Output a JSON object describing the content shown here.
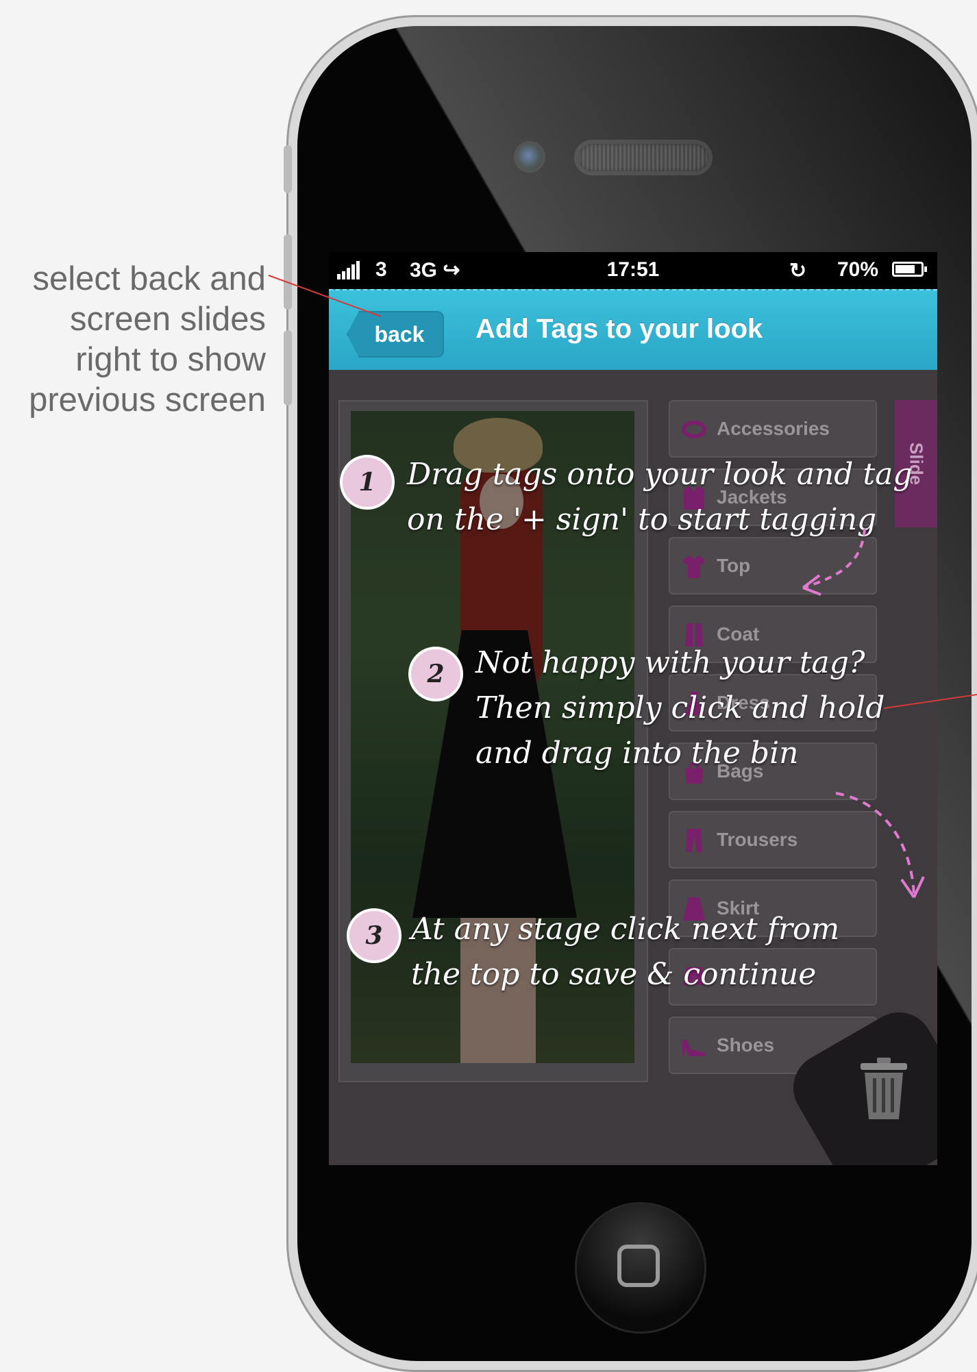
{
  "side_note": {
    "lines": [
      "select back and",
      "screen slides",
      "right to show",
      "previous screen"
    ]
  },
  "status_bar": {
    "carrier": "3",
    "network": "3G",
    "time": "17:51",
    "battery": "70%"
  },
  "nav": {
    "back_label": "back",
    "title": "Add Tags to your look"
  },
  "tags": [
    {
      "label": "Accessories",
      "icon": "accessories-icon"
    },
    {
      "label": "Jackets",
      "icon": "jacket-icon"
    },
    {
      "label": "Top",
      "icon": "top-icon"
    },
    {
      "label": "Coat",
      "icon": "coat-icon"
    },
    {
      "label": "Dress",
      "icon": "dress-icon"
    },
    {
      "label": "Bags",
      "icon": "bag-icon"
    },
    {
      "label": "Trousers",
      "icon": "trousers-icon"
    },
    {
      "label": "Skirt",
      "icon": "skirt-icon"
    },
    {
      "label": "",
      "icon": "shorts-icon"
    },
    {
      "label": "Shoes",
      "icon": "shoe-icon"
    }
  ],
  "slide_tab": "Slide",
  "instructions": [
    {
      "number": "1",
      "lines": [
        "Drag tags onto your look and tag",
        "on the '+ sign' to start tagging"
      ]
    },
    {
      "number": "2",
      "lines": [
        "Not happy with your tag?",
        "Then simply click and hold",
        "and drag into the bin"
      ]
    },
    {
      "number": "3",
      "lines": [
        "At any stage click next from",
        "the top to save & continue"
      ]
    }
  ],
  "colors": {
    "nav_bar": "#2aa6c6",
    "accent_magenta": "#7a1f6b",
    "badge": "#e9c8dd",
    "arrow": "#e07ad0",
    "annotation_line": "#d43a3a"
  }
}
